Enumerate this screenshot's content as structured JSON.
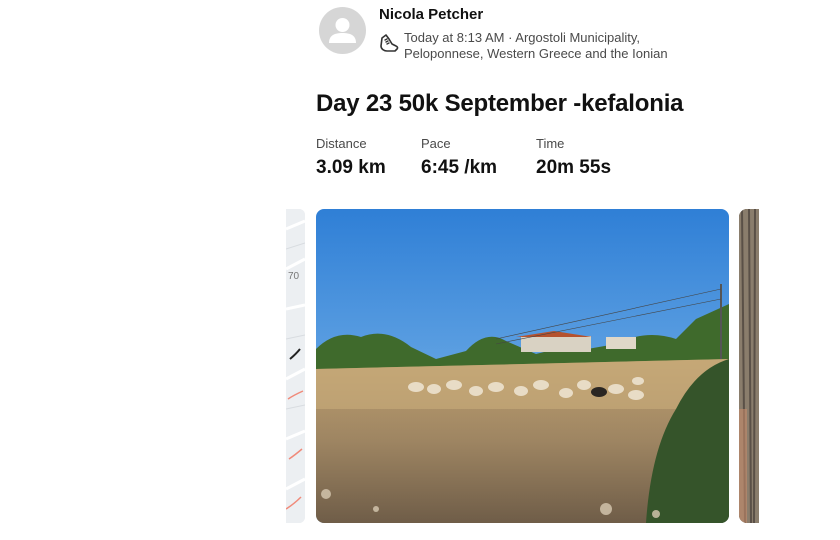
{
  "activity": {
    "athlete_name": "Nicola Petcher",
    "timestamp_location_line1": "Today at 8:13 AM · Argostoli Municipality,",
    "timestamp_location_line2": "Peloponnese, Western Greece and the Ionian",
    "activity_type_icon": "running-shoe-icon",
    "title": "Day 23 50k September -kefalonia"
  },
  "stats": [
    {
      "label": "Distance",
      "value": "3.09 km"
    },
    {
      "label": "Pace",
      "value": "6:45 /km"
    },
    {
      "label": "Time",
      "value": "20m 55s"
    }
  ],
  "media": {
    "map_label": "70",
    "photo_subject": "sheep grazing in dry field near houses"
  },
  "colors": {
    "text_primary": "#111111",
    "text_secondary": "#4a4a4a",
    "avatar_bg": "#d6d6d6"
  }
}
